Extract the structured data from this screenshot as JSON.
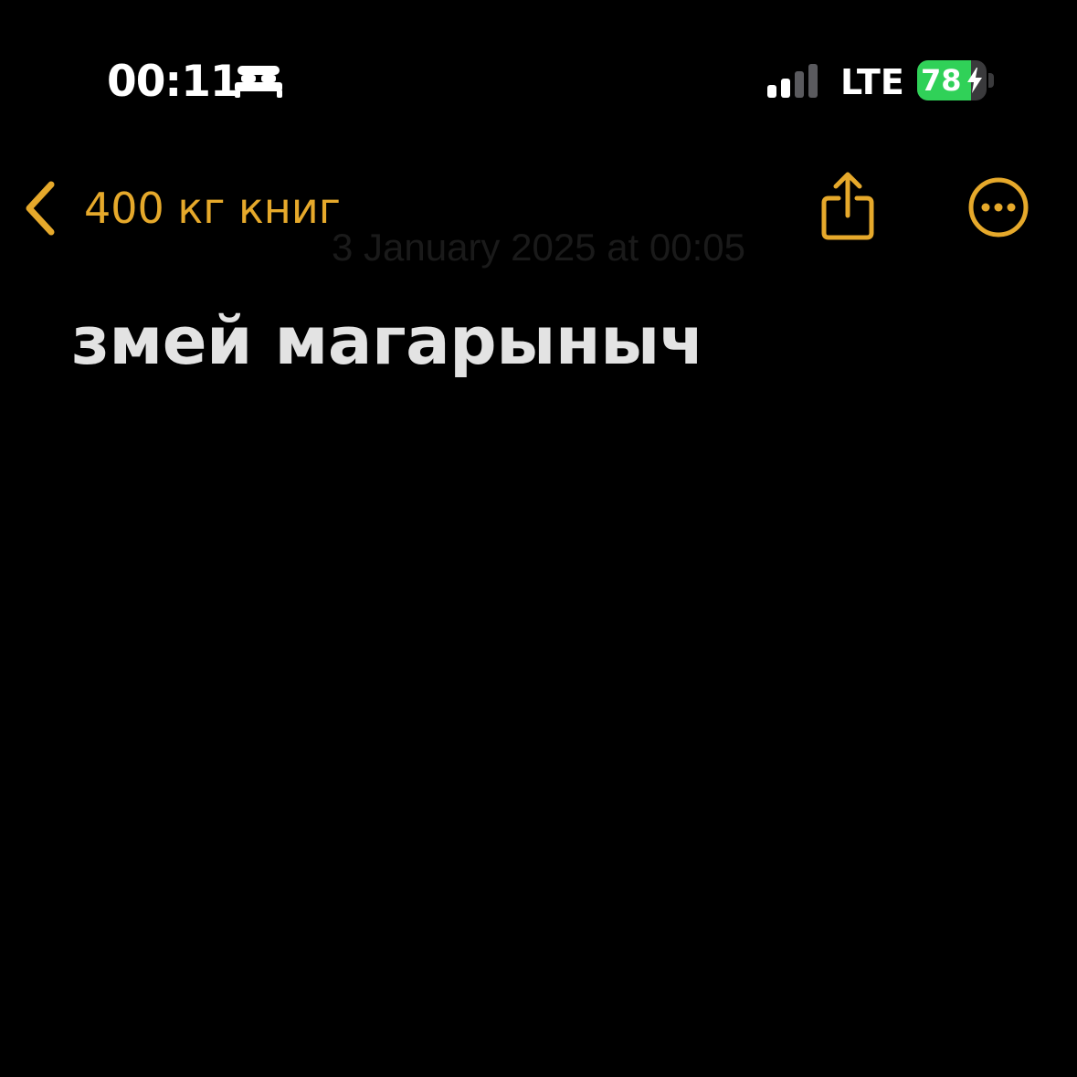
{
  "status_bar": {
    "time": "00:11",
    "focus_icon": "bed-icon",
    "signal_icon": "cellular-signal-icon",
    "signal_bars_active": 2,
    "signal_bars_total": 4,
    "network": "LTE",
    "battery_level": "78",
    "battery_charge_fraction": 0.78,
    "battery_icon": "charging-bolt-icon"
  },
  "nav": {
    "back_icon": "chevron-left-icon",
    "back_label": "400 кг книг",
    "share_icon": "share-icon",
    "more_icon": "ellipsis-circle-icon"
  },
  "note": {
    "date": "3 January 2025 at 00:05",
    "title": "змей магарыныч"
  },
  "colors": {
    "background": "#000000",
    "accent": "#e6a92b",
    "title_text": "#e3e3e3",
    "battery_fill": "#30d158"
  }
}
